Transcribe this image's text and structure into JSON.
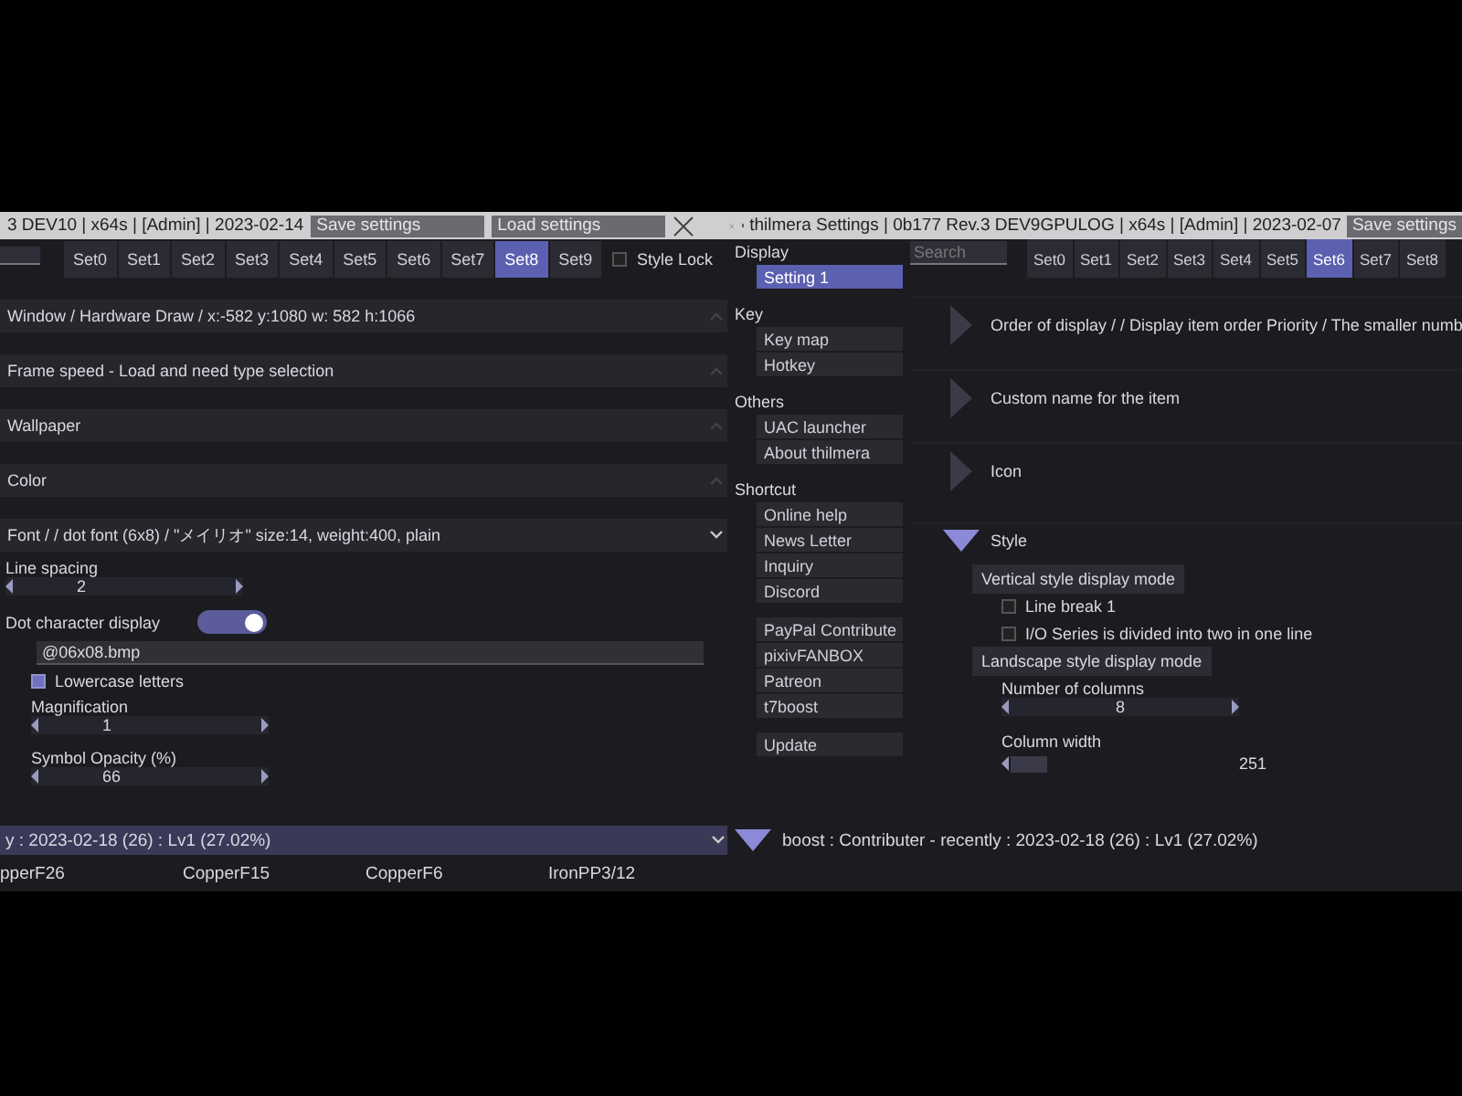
{
  "left_window": {
    "title": "3 DEV10 | x64s | [Admin] | 2023-02-14",
    "buttons": [
      "Save settings",
      "Load settings"
    ],
    "tabs": [
      {
        "label": "Set0",
        "selected": false
      },
      {
        "label": "Set1",
        "selected": false
      },
      {
        "label": "Set2",
        "selected": false
      },
      {
        "label": "Set3",
        "selected": false
      },
      {
        "label": "Set4",
        "selected": false
      },
      {
        "label": "Set5",
        "selected": false
      },
      {
        "label": "Set6",
        "selected": false
      },
      {
        "label": "Set7",
        "selected": false
      },
      {
        "label": "Set8",
        "selected": true
      },
      {
        "label": "Set9",
        "selected": false
      }
    ],
    "style_lock": {
      "label": "Style Lock",
      "checked": false
    },
    "sections": [
      {
        "label": "Window / Hardware Draw / x:-582 y:1080 w: 582 h:1066",
        "expanded": false
      },
      {
        "label": "Frame speed - Load and need type selection",
        "expanded": false
      },
      {
        "label": "Wallpaper",
        "expanded": false
      },
      {
        "label": "Color",
        "expanded": false
      },
      {
        "label": "Font / / dot font (6x8) / \"メイリオ\" size:14, weight:400, plain",
        "expanded": true
      }
    ],
    "settings": [
      {
        "kind": "stepper",
        "label": "Line spacing",
        "value": "2"
      },
      {
        "kind": "toggle",
        "label": "Dot character display",
        "on": true
      },
      {
        "kind": "field",
        "value": "@06x08.bmp"
      },
      {
        "kind": "checkbox",
        "label": "Lowercase letters",
        "checked": true
      },
      {
        "kind": "stepper",
        "label": "Magnification",
        "value": "1"
      },
      {
        "kind": "stepper",
        "label": "Symbol Opacity (%)",
        "value": "66"
      }
    ],
    "status_bar": "y : 2023-02-18 (26) : Lv1 (27.02%)",
    "items": [
      "pperF26",
      "CopperF15",
      "CopperF6",
      "IronPP3/12"
    ]
  },
  "right_window": {
    "title": "thilmera Settings | 0b177 Rev.3 DEV9GPULOG | x64s | [Admin] | 2023-02-07",
    "buttons": [
      "Save settings"
    ],
    "sidebar": [
      {
        "heading": "Display",
        "items": [
          {
            "label": "Setting 1",
            "selected": true
          }
        ]
      },
      {
        "heading": "Key",
        "items": [
          {
            "label": "Key map",
            "selected": false
          },
          {
            "label": "Hotkey",
            "selected": false
          }
        ]
      },
      {
        "heading": "Others",
        "items": [
          {
            "label": "UAC launcher",
            "selected": false
          },
          {
            "label": "About thilmera",
            "selected": false
          }
        ]
      },
      {
        "heading": "Shortcut",
        "items": [
          {
            "label": "Online help",
            "selected": false
          },
          {
            "label": "News Letter",
            "selected": false
          },
          {
            "label": "Inquiry",
            "selected": false
          },
          {
            "label": "Discord",
            "selected": false
          }
        ]
      },
      {
        "items": [
          {
            "label": "PayPal Contribute",
            "selected": false
          },
          {
            "label": "pixivFANBOX",
            "selected": false
          },
          {
            "label": "Patreon",
            "selected": false
          },
          {
            "label": "t7boost",
            "selected": false
          }
        ]
      },
      {
        "items": [
          {
            "label": "Update",
            "selected": false
          }
        ]
      }
    ],
    "search": {
      "placeholder": "Search"
    },
    "tabs": [
      {
        "label": "Set0",
        "selected": false
      },
      {
        "label": "Set1",
        "selected": false
      },
      {
        "label": "Set2",
        "selected": false
      },
      {
        "label": "Set3",
        "selected": false
      },
      {
        "label": "Set4",
        "selected": false
      },
      {
        "label": "Set5",
        "selected": false
      },
      {
        "label": "Set6",
        "selected": true
      },
      {
        "label": "Set7",
        "selected": false
      },
      {
        "label": "Set8",
        "selected": false
      }
    ],
    "sections": [
      {
        "label": "Order of display / / Display item order Priority / The smaller numb",
        "expanded": false
      },
      {
        "label": "Custom name for the item",
        "expanded": false
      },
      {
        "label": "Icon",
        "expanded": false
      },
      {
        "label": "Style",
        "expanded": true
      }
    ],
    "settings": [
      {
        "kind": "header",
        "label": "Vertical style display mode"
      },
      {
        "kind": "checkbox",
        "label": "Line break 1",
        "checked": false
      },
      {
        "kind": "checkbox",
        "label": "I/O Series is divided into two in one line",
        "checked": false
      },
      {
        "kind": "header",
        "label": "Landscape style display mode"
      },
      {
        "kind": "stepper",
        "label": "Number of columns",
        "value": "8"
      },
      {
        "kind": "slider",
        "label": "Column width",
        "value": "251"
      }
    ],
    "status_bar": "boost : Contributer - recently : 2023-02-18 (26) : Lv1 (27.02%)"
  }
}
